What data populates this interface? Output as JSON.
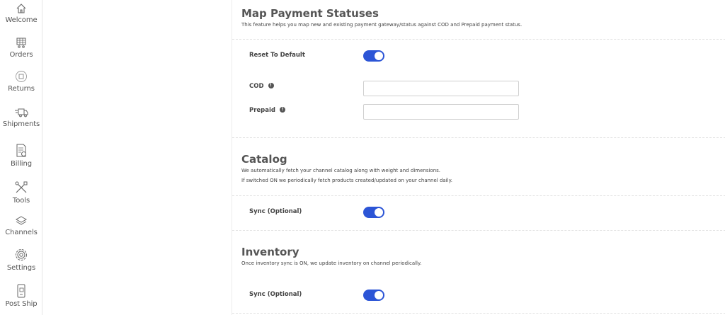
{
  "sidebar": {
    "items": [
      {
        "label": "Welcome"
      },
      {
        "label": "Orders"
      },
      {
        "label": "Returns"
      },
      {
        "label": "Shipments"
      },
      {
        "label": "Billing"
      },
      {
        "label": "Tools"
      },
      {
        "label": "Channels"
      },
      {
        "label": "Settings"
      },
      {
        "label": "Post Ship"
      }
    ]
  },
  "payment_statuses": {
    "title": "Map Payment Statuses",
    "description": "This feature helps you map new and existing payment gateway/status against COD and Prepaid payment status.",
    "reset_label": "Reset To Default",
    "reset_enabled": true,
    "cod_label": "COD",
    "cod_value": "",
    "prepaid_label": "Prepaid",
    "prepaid_value": ""
  },
  "catalog": {
    "title": "Catalog",
    "description_line1": "We automatically fetch your channel catalog along with weight and dimensions.",
    "description_line2": "If switched ON we periodically fetch products created/updated on your channel daily.",
    "sync_label": "Sync (Optional)",
    "sync_enabled": true
  },
  "inventory": {
    "title": "Inventory",
    "description": "Once inventory sync is ON, we update inventory on channel periodically.",
    "sync_label": "Sync (Optional)",
    "sync_enabled": true
  },
  "colors": {
    "toggle_on": "#2c55d6",
    "title_text": "#555555"
  }
}
